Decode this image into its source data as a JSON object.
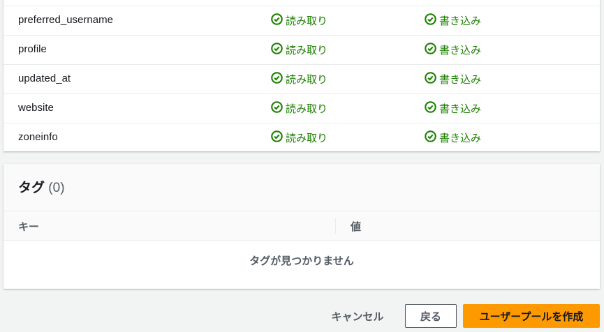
{
  "attributes": [
    {
      "name": "preferred_username",
      "read": "読み取り",
      "write": "書き込み"
    },
    {
      "name": "profile",
      "read": "読み取り",
      "write": "書き込み"
    },
    {
      "name": "updated_at",
      "read": "読み取り",
      "write": "書き込み"
    },
    {
      "name": "website",
      "read": "読み取り",
      "write": "書き込み"
    },
    {
      "name": "zoneinfo",
      "read": "読み取り",
      "write": "書き込み"
    }
  ],
  "tags": {
    "title": "タグ",
    "count": "(0)",
    "col_key": "キー",
    "col_value": "値",
    "empty": "タグが見つかりません"
  },
  "footer": {
    "cancel": "キャンセル",
    "back": "戻る",
    "create": "ユーザープールを作成"
  },
  "colors": {
    "success": "#1d8102",
    "primary": "#ff9900"
  }
}
